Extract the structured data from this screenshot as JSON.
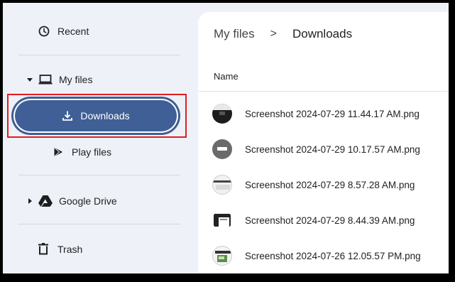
{
  "sidebar": {
    "recent": {
      "label": "Recent",
      "icon": "clock-icon"
    },
    "my_files": {
      "label": "My files",
      "icon": "laptop-icon"
    },
    "downloads": {
      "label": "Downloads",
      "icon": "download-icon"
    },
    "play_files": {
      "label": "Play files",
      "icon": "play-store-icon"
    },
    "google_drive": {
      "label": "Google Drive",
      "icon": "google-drive-icon"
    },
    "trash": {
      "label": "Trash",
      "icon": "trash-icon"
    }
  },
  "breadcrumb": {
    "root": "My files",
    "separator": ">",
    "current": "Downloads"
  },
  "file_list": {
    "column_name": "Name",
    "files": [
      {
        "name": "Screenshot 2024-07-29 11.44.17 AM.png"
      },
      {
        "name": "Screenshot 2024-07-29 10.17.57 AM.png"
      },
      {
        "name": "Screenshot 2024-07-29 8.57.28 AM.png"
      },
      {
        "name": "Screenshot 2024-07-29 8.44.39 AM.png"
      },
      {
        "name": "Screenshot 2024-07-26 12.05.57 PM.png"
      }
    ]
  },
  "colors": {
    "selected_bg": "#3f5f96",
    "highlight_border": "#e11d1d",
    "sidebar_bg": "#eef2f8"
  }
}
